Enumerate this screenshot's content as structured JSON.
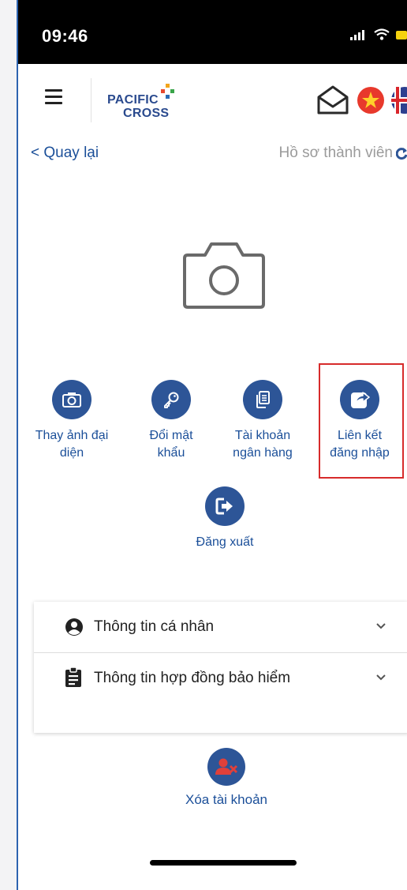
{
  "status_bar": {
    "time": "09:46"
  },
  "header": {
    "logo_line1": "PACIFIC",
    "logo_line2": "CROSS"
  },
  "subheader": {
    "back_label": "< Quay lại",
    "title": "Hồ sơ thành viên"
  },
  "actions": [
    {
      "label_line1": "Thay ảnh đại",
      "label_line2": "diện",
      "icon": "camera-icon"
    },
    {
      "label_line1": "Đổi mật",
      "label_line2": "khẩu",
      "icon": "key-icon"
    },
    {
      "label_line1": "Tài khoản",
      "label_line2": "ngân hàng",
      "icon": "copy-icon"
    },
    {
      "label_line1": "Liên kết",
      "label_line2": "đăng nhập",
      "icon": "share-icon",
      "highlighted": true
    }
  ],
  "logout": {
    "label": "Đăng xuất",
    "icon": "logout-icon"
  },
  "accordion": [
    {
      "label": "Thông tin cá nhân",
      "icon": "user-circle-icon"
    },
    {
      "label": "Thông tin hợp đồng bảo hiểm",
      "icon": "clipboard-icon"
    }
  ],
  "delete_account": {
    "label": "Xóa tài khoản",
    "icon": "user-remove-icon"
  },
  "colors": {
    "primary": "#2d5597",
    "link": "#1b4f99",
    "highlight": "#d72b2b",
    "delete_icon": "#e0403a"
  }
}
